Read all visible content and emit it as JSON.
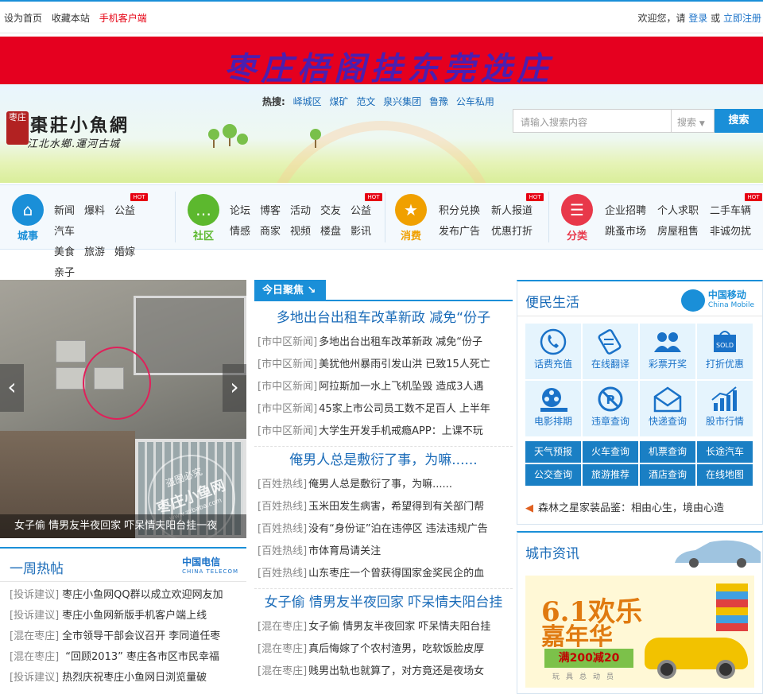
{
  "topbar": {
    "set_home": "设为首页",
    "bookmark": "收藏本站",
    "mobile": "手机客户端",
    "welcome": "欢迎您，请",
    "login": "登录",
    "or": "或",
    "register": "立即注册"
  },
  "banner": {
    "text": "枣庄梧阁挂东莞选庄"
  },
  "logo": {
    "seal": "枣庄",
    "title": "棗莊小魚網",
    "slogan": "江北水鄉.運河古城"
  },
  "hot_search": {
    "label": "热搜:",
    "keywords": [
      "峄城区",
      "煤矿",
      "范文",
      "泉兴集团",
      "鲁豫",
      "公车私用"
    ]
  },
  "search": {
    "placeholder": "请输入搜索内容",
    "select": "搜索",
    "button": "搜索"
  },
  "nav": [
    {
      "caption": "城事",
      "color": "#1a8fd8",
      "icon": "home-icon",
      "row1": [
        "新闻",
        "爆料",
        "公益",
        "汽车"
      ],
      "row2": [
        "美食",
        "旅游",
        "婚嫁",
        "亲子"
      ],
      "hot": "HOT"
    },
    {
      "caption": "社区",
      "color": "#5cb82e",
      "icon": "chat-icon",
      "row1": [
        "论坛",
        "博客",
        "活动",
        "交友",
        "公益"
      ],
      "row2": [
        "情感",
        "商家",
        "视频",
        "楼盘",
        "影讯"
      ],
      "hot": "HOT"
    },
    {
      "caption": "消费",
      "color": "#f0a000",
      "icon": "bag-icon",
      "row1": [
        "积分兑换",
        "新人报道"
      ],
      "row2": [
        "发布广告",
        "优惠打折"
      ],
      "hot": "HOT"
    },
    {
      "caption": "分类",
      "color": "#e8384a",
      "icon": "list-icon",
      "row1": [
        "企业招聘",
        "个人求职",
        "二手车辆"
      ],
      "row2": [
        "跳蚤市场",
        "房屋租售",
        "非诚勿扰"
      ],
      "hot": "HOT"
    }
  ],
  "slider": {
    "caption": "女子偷 情男友半夜回家 吓呆情夫阳台挂一夜",
    "watermark_top": "盗图必究",
    "watermark_big": "枣庄小鱼网",
    "watermark_url": "www.zzbaba.com"
  },
  "weekly": {
    "title": "一周热帖",
    "telecom": "中国电信",
    "telecom_sub": "CHINA TELECOM",
    "items": [
      {
        "tag": "[投诉建议]",
        "text": "枣庄小鱼网QQ群以成立欢迎网友加"
      },
      {
        "tag": "[投诉建议]",
        "text": "枣庄小鱼网新版手机客户端上线"
      },
      {
        "tag": "[混在枣庄]",
        "text": "全市领导干部会议召开 李同道任枣"
      },
      {
        "tag": "[混在枣庄]",
        "text": " “回顾2013” 枣庄各市区市民幸福"
      },
      {
        "tag": "[投诉建议]",
        "text": "热烈庆祝枣庄小鱼网日浏览量破"
      }
    ]
  },
  "center": {
    "tab": "今日聚焦",
    "sections": [
      {
        "headline": "多地出台出租车改革新政 减免“份子",
        "items": [
          {
            "tag": "[市中区新闻]",
            "text": "多地出台出租车改革新政 减免“份子"
          },
          {
            "tag": "[市中区新闻]",
            "text": "美犹他州暴雨引发山洪 已致15人死亡"
          },
          {
            "tag": "[市中区新闻]",
            "text": "阿拉斯加一水上飞机坠毁 造成3人遇"
          },
          {
            "tag": "[市中区新闻]",
            "text": "45家上市公司员工数不足百人 上半年"
          },
          {
            "tag": "[市中区新闻]",
            "text": "大学生开发手机戒瘾APP：上课不玩"
          }
        ]
      },
      {
        "headline": "俺男人总是敷衍了事，为嘛......",
        "items": [
          {
            "tag": "[百姓热线]",
            "text": "俺男人总是敷衍了事，为嘛......"
          },
          {
            "tag": "[百姓热线]",
            "text": "玉米田发生病害，希望得到有关部门帮"
          },
          {
            "tag": "[百姓热线]",
            "text": "没有“身份证”泊在违停区 违法违规广告"
          },
          {
            "tag": "[百姓热线]",
            "text": "市体育局请关注"
          },
          {
            "tag": "[百姓热线]",
            "text": "山东枣庄一个曾获得国家金奖民企的血"
          }
        ]
      },
      {
        "headline": "女子偷 情男友半夜回家 吓呆情夫阳台挂",
        "items": [
          {
            "tag": "[混在枣庄]",
            "text": "女子偷 情男友半夜回家 吓呆情夫阳台挂"
          },
          {
            "tag": "[混在枣庄]",
            "text": "真后悔嫁了个农村渣男，吃软饭脸皮厚"
          },
          {
            "tag": "[混在枣庄]",
            "text": "贱男出轨也就算了，对方竟还是夜场女"
          }
        ]
      }
    ]
  },
  "services": {
    "title": "便民生活",
    "cm": "中国移动",
    "cm_sub": "China Mobile",
    "cells": [
      {
        "label": "话费充值",
        "icon": "phone-icon"
      },
      {
        "label": "在线翻译",
        "icon": "translate-icon"
      },
      {
        "label": "彩票开奖",
        "icon": "lottery-icon"
      },
      {
        "label": "打折优惠",
        "icon": "sold-tag-icon",
        "badge": "SOLD"
      },
      {
        "label": "电影排期",
        "icon": "film-icon"
      },
      {
        "label": "违章查询",
        "icon": "no-parking-icon"
      },
      {
        "label": "快递查询",
        "icon": "mail-icon"
      },
      {
        "label": "股市行情",
        "icon": "stock-chart-icon"
      }
    ],
    "buttons": [
      "天气预报",
      "火车查询",
      "机票查询",
      "长途汽车",
      "公交查询",
      "旅游推荐",
      "酒店查询",
      "在线地图"
    ],
    "notice": "森林之星家装品鉴：相由心生，境由心造"
  },
  "city": {
    "title": "城市资讯",
    "ad_line1": "6.1欢乐",
    "ad_line2": "嘉年华",
    "ad_promo": "满200减20",
    "ad_sub": "玩具总动员"
  }
}
